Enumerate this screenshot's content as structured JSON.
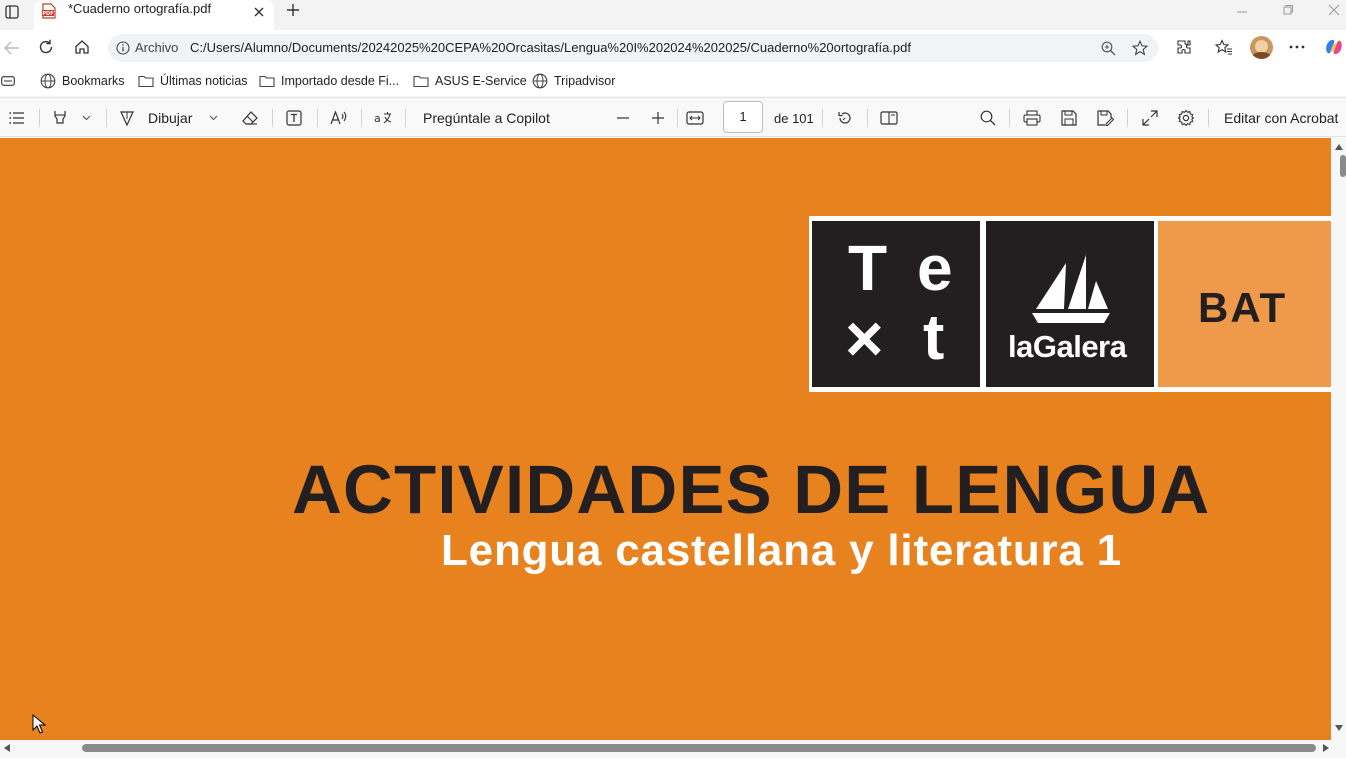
{
  "browser": {
    "tab_title": "*Cuaderno ortografía.pdf",
    "address_scheme": "Archivo",
    "address_url": "C:/Users/Alumno/Documents/20242025%20CEPA%20Orcasitas/Lengua%20I%202024%202025/Cuaderno%20ortografía.pdf"
  },
  "bookmarks": [
    {
      "label": "Bookmarks",
      "icon": "globe-icon"
    },
    {
      "label": "Últimas noticias",
      "icon": "folder-icon"
    },
    {
      "label": "Importado desde Fi...",
      "icon": "folder-icon"
    },
    {
      "label": "ASUS E-Service",
      "icon": "folder-icon"
    },
    {
      "label": "Tripadvisor",
      "icon": "globe-icon"
    }
  ],
  "pdf_toolbar": {
    "draw_label": "Dibujar",
    "copilot_label": "Pregúntale a Copilot",
    "page_current": "1",
    "page_total_label": "de 101",
    "edit_acrobat_label": "Editar con Acrobat"
  },
  "document": {
    "logo_letters": [
      "T",
      "e",
      "×",
      "t"
    ],
    "publisher": "laGalera",
    "level": "BAT",
    "heading": "ACTIVIDADES DE LENGUA",
    "subheading": "Lengua castellana y literatura 1"
  },
  "colors": {
    "page_orange": "#e8821f",
    "logo_dark": "#231f20",
    "logo_light_orange": "#ee9a4a"
  }
}
